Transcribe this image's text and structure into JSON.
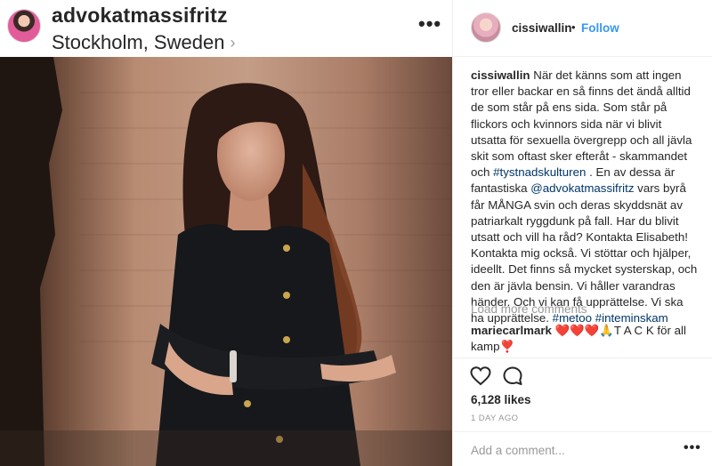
{
  "post": {
    "location_account": "advokatmassifritz",
    "location": "Stockholm, Sweden",
    "author": "cissiwallin",
    "follow_label": "Follow",
    "separator": "•",
    "caption_username": "cissiwallin",
    "caption_part1": " När det känns som att ingen tror eller backar en så finns det ändå alltid de som står på ens sida. Som står på flickors och kvinnors sida när vi blivit utsatta för sexuella övergrepp och all jävla skit som oftast sker efteråt - skammandet och ",
    "hashtag1": "#tystnadskulturen",
    "caption_part2": " . En av dessa är fantastiska ",
    "mention": "@advokatmassifritz",
    "caption_part3": " vars byrå får MÅNGA svin och deras skyddsnät av patriarkalt ryggdunk på fall. Har du blivit utsatt och vill ha råd? Kontakta Elisabeth! Kontakta mig också. Vi stöttar och hjälper, ideellt. Det finns så mycket systerskap, och den är jävla bensin. Vi håller varandras händer. Och vi kan få upprättelse. Vi ska ha upprättelse. ",
    "hashtag2": "#metoo",
    "hashtag3": "#inteminskam",
    "load_more": "Load more comments",
    "comment_user": "mariecarlmark",
    "comment_text": " ❤️❤️❤️🙏T A C K för all kamp❣️",
    "likes": "6,128 likes",
    "timestamp": "1 DAY AGO",
    "add_comment_placeholder": "Add a comment...",
    "more_options": "•••",
    "header_more": "•••",
    "chevron": "›"
  },
  "colors": {
    "link": "#003569",
    "follow": "#3897f0",
    "muted": "#999999",
    "text": "#262626"
  }
}
